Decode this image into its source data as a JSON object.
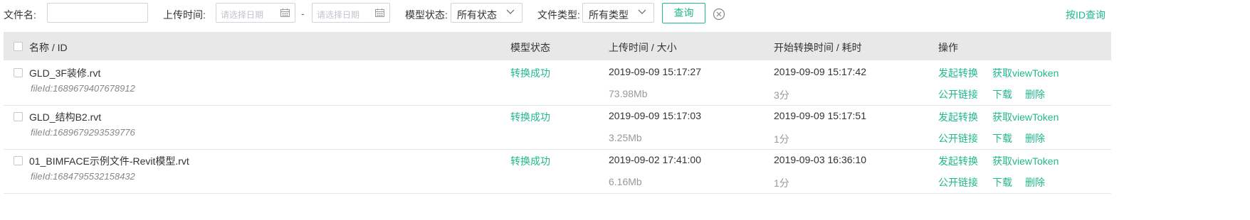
{
  "filters": {
    "file_name_label": "文件名:",
    "file_name_value": "",
    "upload_time_label": "上传时间:",
    "date_start_placeholder": "请选择日期",
    "date_separator": "-",
    "date_end_placeholder": "请选择日期",
    "model_status_label": "模型状态:",
    "model_status_value": "所有状态",
    "file_type_label": "文件类型:",
    "file_type_value": "所有类型",
    "query_button": "查询",
    "id_query_link": "按ID查询"
  },
  "table": {
    "columns": {
      "name": "名称 / ID",
      "status": "模型状态",
      "upload": "上传时间 / 大小",
      "convert": "开始转换时间 / 耗时",
      "actions": "操作"
    },
    "file_id_prefix": "fileId:",
    "rows": [
      {
        "name": "GLD_3F装修.rvt",
        "file_id": "1689679407678912",
        "status": "转换成功",
        "upload_time": "2019-09-09 15:17:27",
        "size": "73.98Mb",
        "convert_start": "2019-09-09 15:17:42",
        "duration": "3分",
        "actions": {
          "convert": "发起转换",
          "token": "获取viewToken",
          "share": "公开链接",
          "download": "下载",
          "delete": "删除"
        }
      },
      {
        "name": "GLD_结构B2.rvt",
        "file_id": "1689679293539776",
        "status": "转换成功",
        "upload_time": "2019-09-09 15:17:03",
        "size": "3.25Mb",
        "convert_start": "2019-09-09 15:17:51",
        "duration": "1分",
        "actions": {
          "convert": "发起转换",
          "token": "获取viewToken",
          "share": "公开链接",
          "download": "下载",
          "delete": "删除"
        }
      },
      {
        "name": "01_BIMFACE示例文件-Revit模型.rvt",
        "file_id": "1684795532158432",
        "status": "转换成功",
        "upload_time": "2019-09-02 17:41:00",
        "size": "6.16Mb",
        "convert_start": "2019-09-03 16:36:10",
        "duration": "1分",
        "actions": {
          "convert": "发起转换",
          "token": "获取viewToken",
          "share": "公开链接",
          "download": "下载",
          "delete": "删除"
        }
      }
    ]
  },
  "colors": {
    "accent": "#1fb98c",
    "header_bg": "#e8e8e8"
  }
}
